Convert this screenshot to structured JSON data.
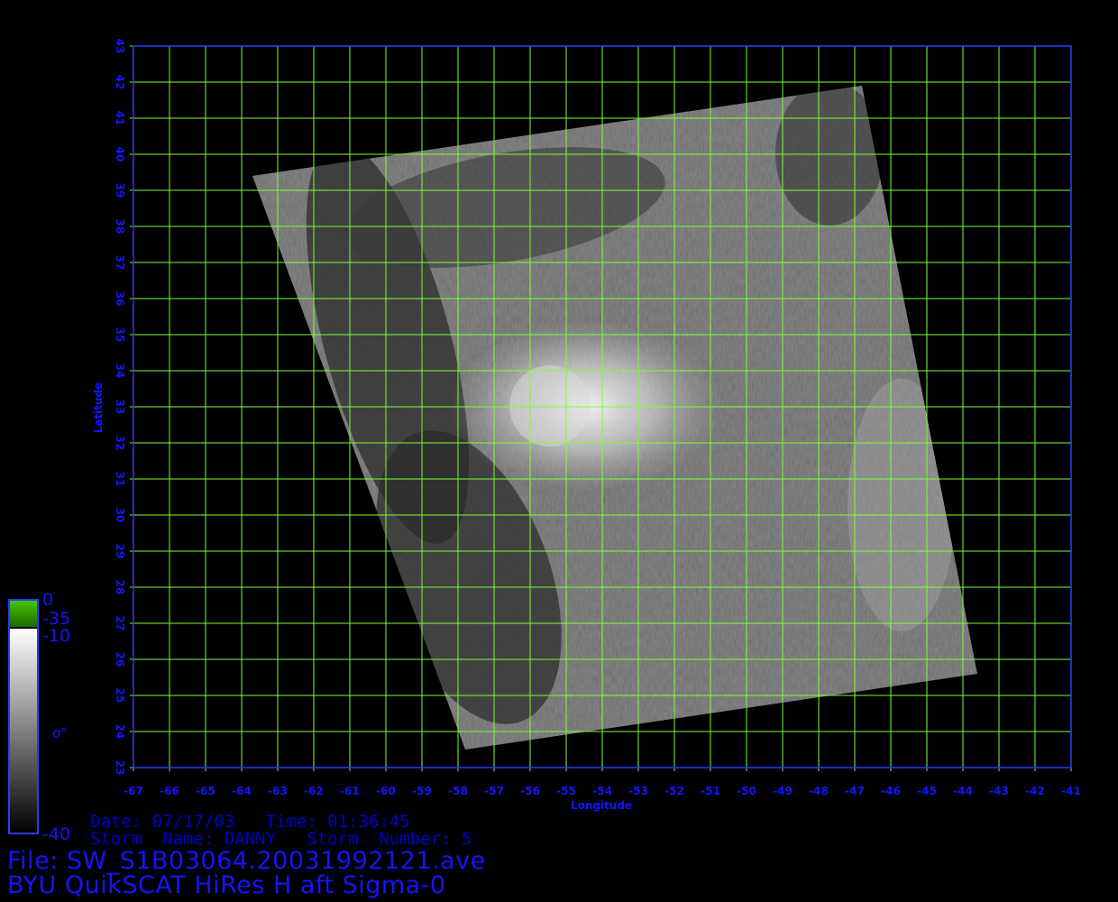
{
  "map": {
    "x_axis_label": "Longitude",
    "y_axis_label": "Latitude",
    "lon_ticks": [
      "-67",
      "-66",
      "-65",
      "-64",
      "-63",
      "-62",
      "-61",
      "-60",
      "-59",
      "-58",
      "-57",
      "-56",
      "-55",
      "-54",
      "-53",
      "-52",
      "-51",
      "-50",
      "-49",
      "-48",
      "-47",
      "-46",
      "-45",
      "-44",
      "-43",
      "-42",
      "-41"
    ],
    "lat_ticks": [
      "23",
      "24",
      "25",
      "26",
      "27",
      "28",
      "29",
      "30",
      "31",
      "32",
      "33",
      "34",
      "35",
      "36",
      "37",
      "38",
      "39",
      "40",
      "41",
      "42",
      "43"
    ],
    "lon_range": [
      -67,
      -41
    ],
    "lat_range": [
      23,
      43
    ],
    "swath_corners_lonlat": [
      [
        -63.7,
        39.4
      ],
      [
        -46.8,
        41.9
      ],
      [
        -43.6,
        25.6
      ],
      [
        -57.8,
        23.5
      ]
    ],
    "grid_color": "#7cfc3c",
    "frame_color": "#2a3cff",
    "label_color": "#1414ff"
  },
  "colorbar": {
    "labels": [
      "0",
      "-35",
      "-10",
      "σ°",
      "-40"
    ],
    "colors": {
      "top": "#33aa00",
      "white": "#ffffff",
      "black": "#000000"
    }
  },
  "info": {
    "date_line": "Date: 07/17/03   Time: 01:36:45",
    "storm_line": "Storm  Name: DANNY   Storm  Number: 5",
    "file_line": "File: SW_S1B03064.20031992121.ave",
    "title_line": "BYU QuikSCAT HiRes H aft Sigma-0"
  }
}
